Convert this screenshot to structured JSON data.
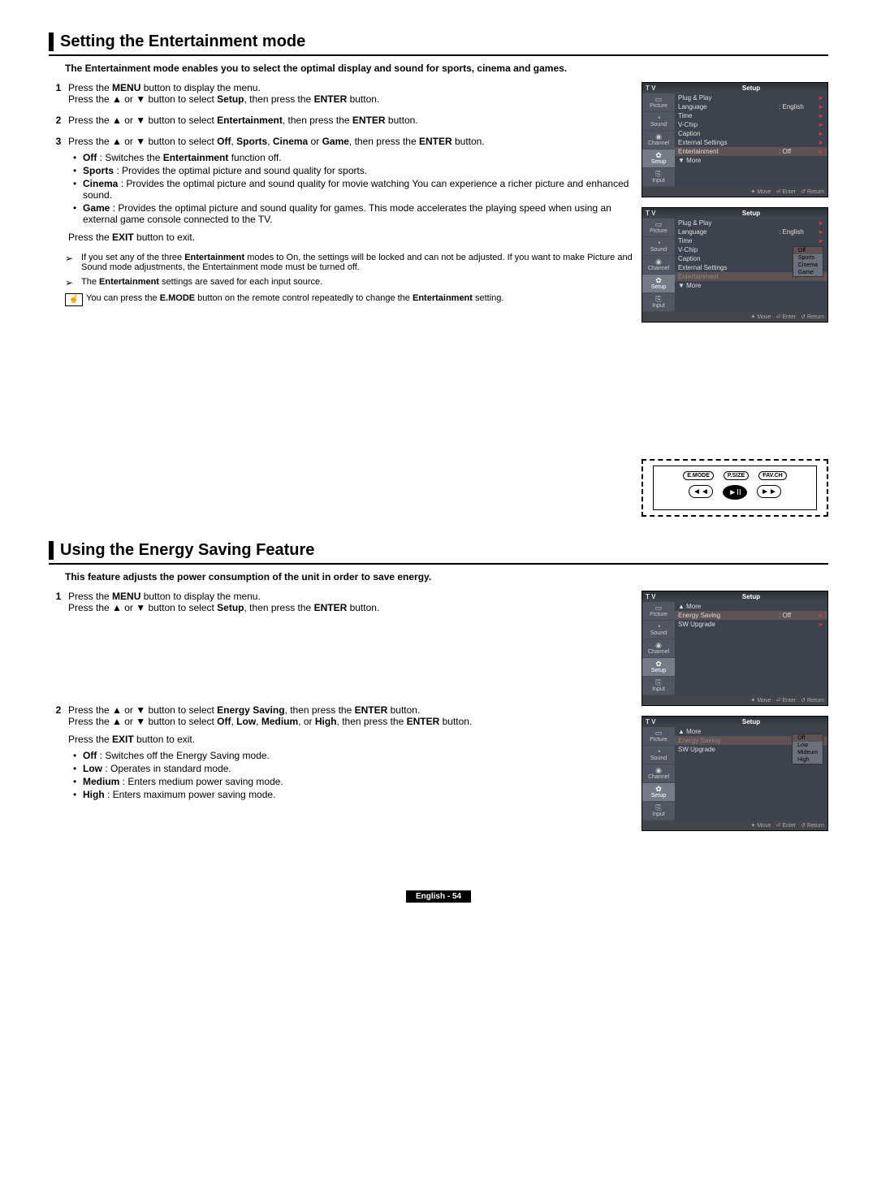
{
  "section1": {
    "title": "Setting the Entertainment mode",
    "intro": "The Entertainment mode enables you to select the optimal display and sound for sports, cinema and games.",
    "steps": {
      "s1_a": "Press the ",
      "s1_b": "MENU",
      "s1_c": " button to display the menu.",
      "s1_d": "Press the ▲ or ▼ button to select ",
      "s1_e": "Setup",
      "s1_f": ", then press the ",
      "s1_g": "ENTER",
      "s1_h": " button.",
      "s2_a": "Press the ▲ or ▼ button to select ",
      "s2_b": "Entertainment",
      "s2_c": ", then press the ",
      "s2_d": "ENTER",
      "s2_e": " button.",
      "s3_a": "Press the ▲ or ▼ button to select ",
      "s3_b": "Off",
      "s3_c": ", ",
      "s3_d": "Sports",
      "s3_e": ", ",
      "s3_f": "Cinema",
      "s3_g": " or ",
      "s3_h": "Game",
      "s3_i": ", then press the ",
      "s3_j": "ENTER",
      "s3_k": " button."
    },
    "bullets": {
      "b1a": "Off",
      "b1b": " : Switches the ",
      "b1c": "Entertainment",
      "b1d": " function off.",
      "b2a": "Sports",
      "b2b": " : Provides the optimal picture and sound quality for sports.",
      "b3a": "Cinema",
      "b3b": " : Provides the optimal picture and sound quality for movie watching You can experience a richer picture and enhanced sound.",
      "b4a": "Game",
      "b4b": " : Provides the optimal picture and sound quality for games. This mode accelerates the playing speed when using an external game console connected to the TV."
    },
    "exit_a": "Press the ",
    "exit_b": "EXIT",
    "exit_c": " button to exit.",
    "n1_a": "If you set any of the three ",
    "n1_b": "Entertainment",
    "n1_c": " modes to On, the settings will be locked and can not be adjusted. If you want to make Picture and Sound mode adjustments, the Entertainment mode must be turned off.",
    "n2_a": "The ",
    "n2_b": "Entertainment",
    "n2_c": " settings are saved for each input source.",
    "n3_a": "You can press the ",
    "n3_b": "E.MODE",
    "n3_c": " button on the remote control repeatedly to change the ",
    "n3_d": "Entertainment",
    "n3_e": " setting."
  },
  "section2": {
    "title": "Using the Energy Saving Feature",
    "intro": "This feature adjusts the power consumption of the unit in order to save energy.",
    "s1_a": "Press the ",
    "s1_b": "MENU",
    "s1_c": " button to display the menu.",
    "s1_d": "Press the ▲ or ▼ button to select ",
    "s1_e": "Setup",
    "s1_f": ", then press the ",
    "s1_g": "ENTER",
    "s1_h": " button.",
    "s2_a": "Press the ▲ or ▼ button to select ",
    "s2_b": "Energy Saving",
    "s2_c": ", then press the ",
    "s2_d": "ENTER",
    "s2_e": " button.",
    "s2_f": "Press the ▲ or ▼ button to select ",
    "s2_g": "Off",
    "s2_h": ", ",
    "s2_i": "Low",
    "s2_j": ", ",
    "s2_k": "Medium",
    "s2_l": ", or ",
    "s2_m": "High",
    "s2_n": ", then press the ",
    "s2_o": "ENTER",
    "s2_p": " button.",
    "exit_a": "Press the ",
    "exit_b": "EXIT",
    "exit_c": " button to exit.",
    "b1a": "Off",
    "b1b": " : Switches off the Energy Saving mode.",
    "b2a": "Low",
    "b2b": " : Operates in standard mode.",
    "b3a": "Medium",
    "b3b": " : Enters medium power saving mode.",
    "b4a": "High",
    "b4b": " : Enters maximum power saving mode."
  },
  "osd": {
    "tv": "T V",
    "setup": "Setup",
    "side": {
      "picture": "Picture",
      "sound": "Sound",
      "channel": "Channel",
      "setup_side": "Setup",
      "input": "Input"
    },
    "rows1": {
      "plug": "Plug & Play",
      "lang": "Language",
      "lang_v": ": English",
      "time": "Time",
      "vchip": "V-Chip",
      "caption": "Caption",
      "ext": "External Settings",
      "ent": "Entertainment",
      "ent_v": ": Off",
      "more": "▼ More"
    },
    "drop_ent": {
      "off": "Off",
      "sports": "Sports",
      "cinema": "Cinema",
      "game": "Game"
    },
    "rows3": {
      "more_up": "▲ More",
      "es": "Energy Saving",
      "es_v": ": Off",
      "sw": "SW Upgrade"
    },
    "drop_es": {
      "off": "Off",
      "low": "Low",
      "mid": "Mideum",
      "high": "High"
    },
    "foot": {
      "move": "Move",
      "enter": "Enter",
      "return": "Return"
    }
  },
  "remote": {
    "emode": "E.MODE",
    "psize": "P.SIZE",
    "favch": "FAV.CH",
    "rw": "◄◄",
    "play": "►II",
    "ff": "►►"
  },
  "footer": "English - 54",
  "arrow": "➢",
  "arw_r": "►"
}
